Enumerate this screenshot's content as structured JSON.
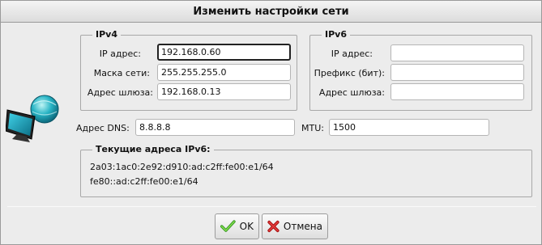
{
  "window": {
    "title": "Изменить настройки сети"
  },
  "ipv4": {
    "title": "IPv4",
    "ip_label": "IP адрес:",
    "ip_value": "192.168.0.60",
    "mask_label": "Маска сети:",
    "mask_value": "255.255.255.0",
    "gateway_label": "Адрес шлюза:",
    "gateway_value": "192.168.0.13"
  },
  "ipv6": {
    "title": "IPv6",
    "ip_label": "IP адрес:",
    "ip_value": "",
    "prefix_label": "Префикс (бит):",
    "prefix_value": "",
    "gateway_label": "Адрес шлюза:",
    "gateway_value": ""
  },
  "dns": {
    "label": "Адрес DNS:",
    "value": "8.8.8.8"
  },
  "mtu": {
    "label": "MTU:",
    "value": "1500"
  },
  "current_ipv6": {
    "title": "Текущие адреса IPv6:",
    "addresses": [
      "2a03:1ac0:2e92:d910:ad:c2ff:fe00:e1/64",
      "fe80::ad:c2ff:fe00:e1/64"
    ]
  },
  "buttons": {
    "ok": "OK",
    "cancel": "Отмена"
  },
  "icons": {
    "network": "network-monitor-globe-icon",
    "ok": "checkmark-icon",
    "cancel": "red-x-icon"
  }
}
